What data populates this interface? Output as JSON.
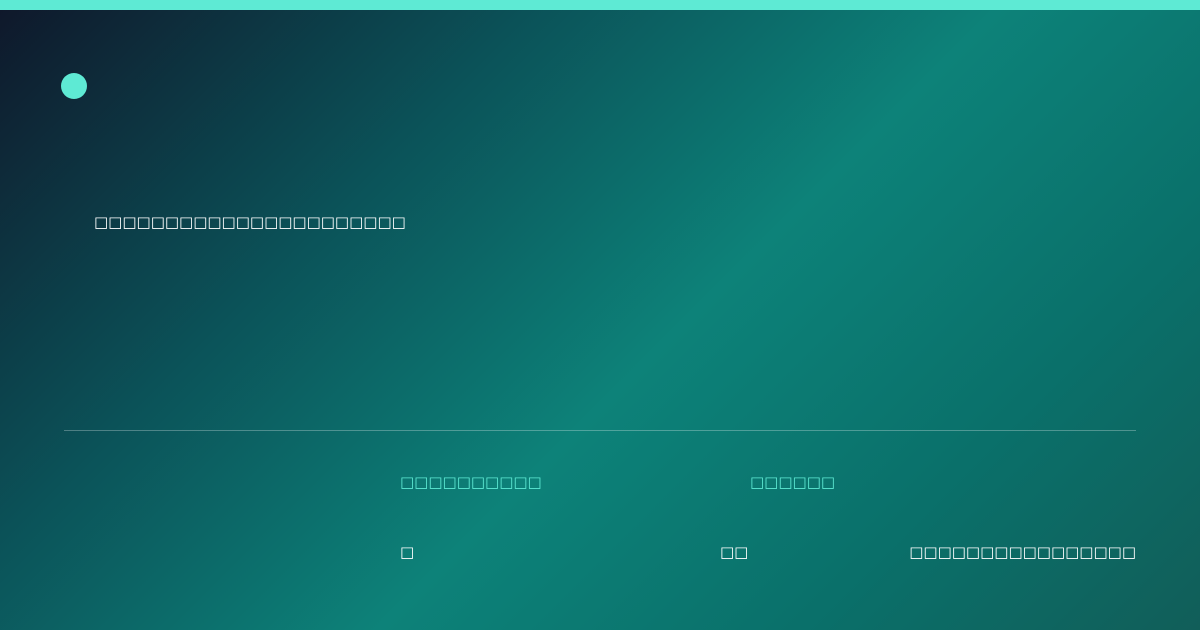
{
  "colors": {
    "accent": "#5eead4",
    "background_start": "#0f172a",
    "background_mid": "#0d8279",
    "background_end": "#115e59"
  },
  "icons": {
    "brand": "brand-dot-icon"
  },
  "headline": "□□□□□□□□□□□□□□□□□□□□□□",
  "details": {
    "label_1": "□□□□□□□□□□",
    "label_2": "□□□□□□",
    "value_1": "□",
    "value_2": "□□",
    "value_3": "□□□□□□□□□□□□□□□□"
  }
}
